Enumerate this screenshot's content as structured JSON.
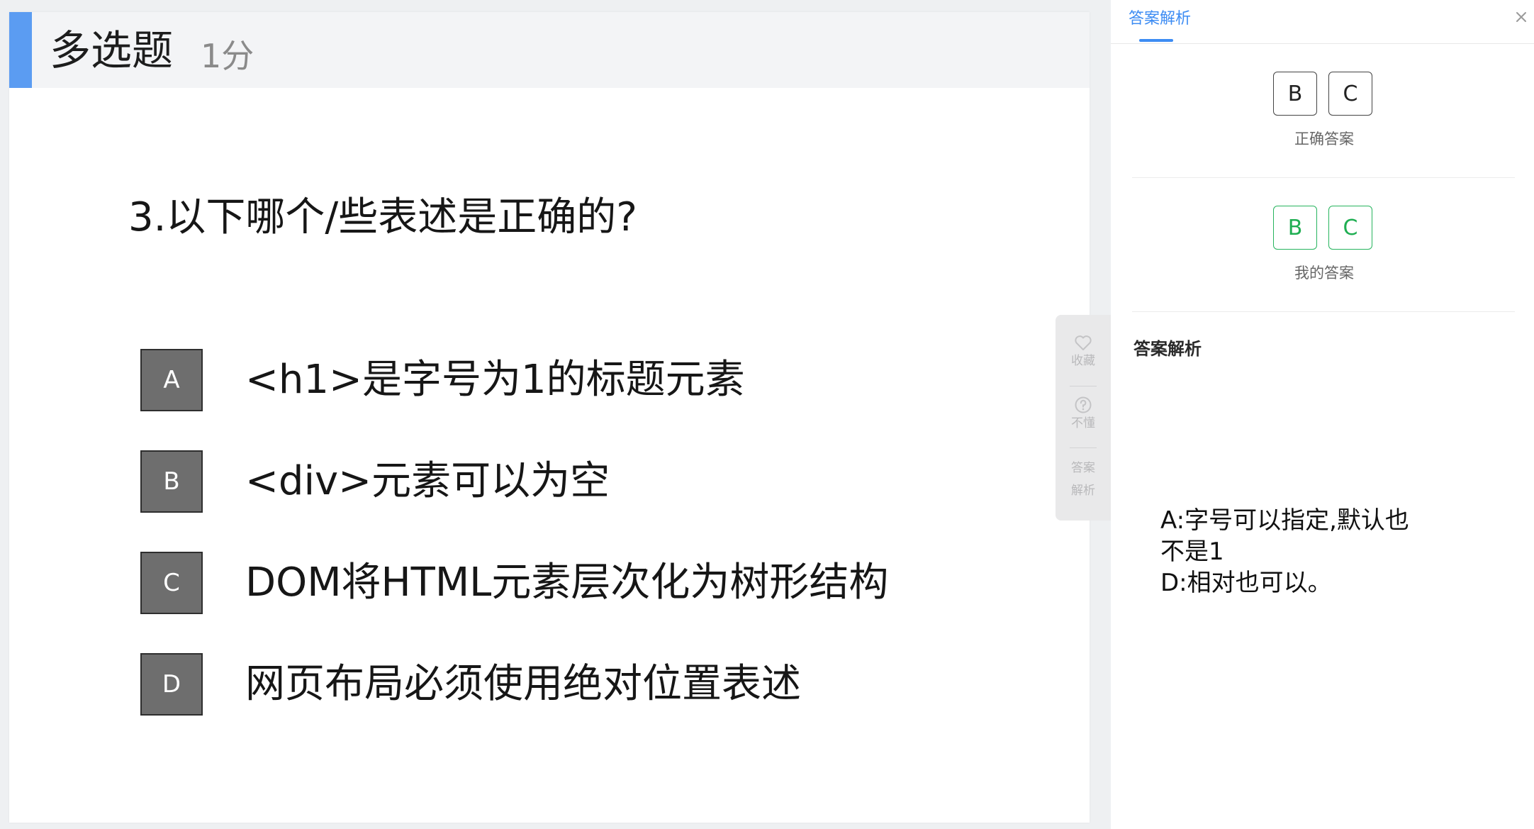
{
  "question": {
    "type_label": "多选题",
    "score": "1分",
    "stem": "3.以下哪个/些表述是正确的?",
    "options": [
      {
        "letter": "A",
        "text": "<h1>是字号为1的标题元素"
      },
      {
        "letter": "B",
        "text": "<div>元素可以为空"
      },
      {
        "letter": "C",
        "text": "DOM将HTML元素层次化为树形结构"
      },
      {
        "letter": "D",
        "text": "网页布局必须使用绝对位置表述"
      }
    ]
  },
  "tools": {
    "favorite": {
      "label": "收藏",
      "icon": "heart-icon"
    },
    "confused": {
      "label": "不懂",
      "icon": "question-circle-icon"
    },
    "analysis": {
      "label_line1": "答案",
      "label_line2": "解析"
    }
  },
  "panel": {
    "tab_label": "答案解析",
    "close_icon": "close-icon",
    "correct_answer": {
      "choices": [
        "B",
        "C"
      ],
      "caption": "正确答案"
    },
    "my_answer": {
      "choices": [
        "B",
        "C"
      ],
      "caption": "我的答案",
      "color": "#1fae52"
    },
    "analysis_title": "答案解析",
    "analysis_lines": [
      "A:字号可以指定,默认也",
      "不是1",
      "D:相对也可以。"
    ]
  },
  "colors": {
    "accent_blue": "#3d8cf3",
    "header_bar": "#5b9cf2",
    "option_box": "#6e6e6e",
    "correct_green": "#1fae52"
  }
}
